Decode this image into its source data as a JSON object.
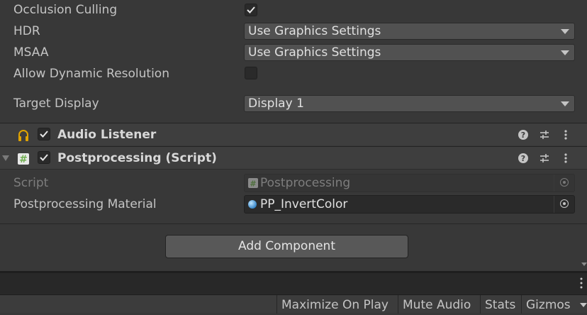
{
  "camera": {
    "occlusion_culling": {
      "label": "Occlusion Culling",
      "checked": true
    },
    "hdr": {
      "label": "HDR",
      "value": "Use Graphics Settings"
    },
    "msaa": {
      "label": "MSAA",
      "value": "Use Graphics Settings"
    },
    "dynamic_resolution": {
      "label": "Allow Dynamic Resolution",
      "checked": false
    },
    "target_display": {
      "label": "Target Display",
      "value": "Display 1"
    }
  },
  "components": {
    "audio_listener": {
      "title": "Audio Listener",
      "enabled": true,
      "icon": "headphones-icon"
    },
    "postprocessing": {
      "title": "Postprocessing (Script)",
      "enabled": true,
      "icon": "script-hash-icon",
      "script_label": "Script",
      "script_value": "Postprocessing",
      "material_label": "Postprocessing Material",
      "material_value": "PP_InvertColor"
    }
  },
  "add_component": {
    "label": "Add Component"
  },
  "toolbar": {
    "maximize": "Maximize On Play",
    "mute": "Mute Audio",
    "stats": "Stats",
    "gizmos": "Gizmos"
  },
  "colors": {
    "background": "#383838",
    "accent_audio": "#e0a300",
    "script_icon": "#6fae4f"
  }
}
